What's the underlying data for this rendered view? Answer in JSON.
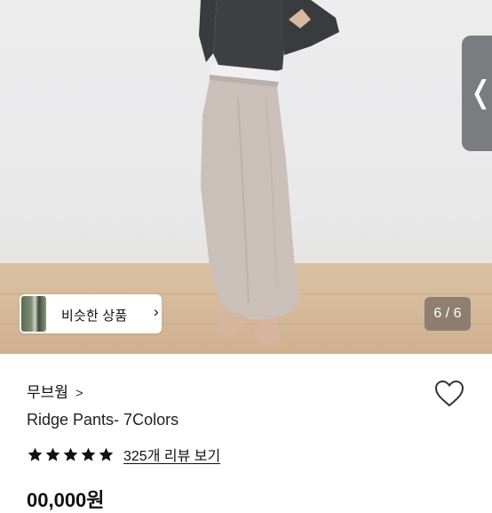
{
  "gallery": {
    "similar_label": "비슷한 상품",
    "similar_chevron": "›",
    "counter": "6 / 6",
    "side_chevron": "❬",
    "icons": {
      "similar_thumb": "product-thumbnail",
      "side": "chevron-left-icon"
    }
  },
  "product": {
    "brand": "무브웜",
    "brand_chevron": ">",
    "title": "Ridge Pants- 7Colors",
    "rating": 5,
    "reviews_link": "325개 리뷰 보기",
    "price": "00,000원"
  },
  "colors": {
    "star": "#111111",
    "accent_overlay": "#7b7c80",
    "text": "#111111"
  }
}
